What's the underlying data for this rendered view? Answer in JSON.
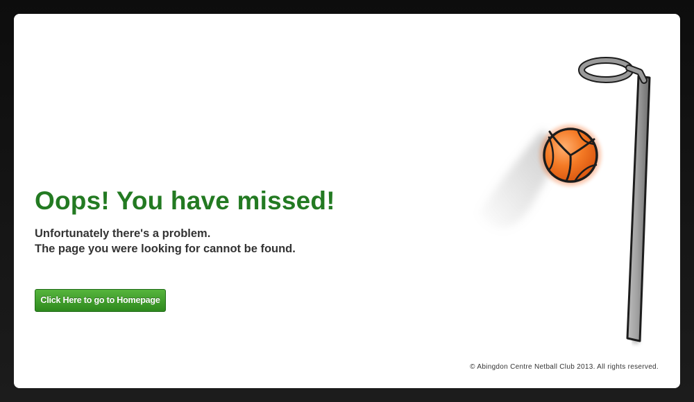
{
  "error": {
    "heading": "Oops! You have missed!",
    "line1": "Unfortunately there's a problem.",
    "line2": "The page you were looking for cannot be found."
  },
  "actions": {
    "home_label": "Click Here to go to Homepage"
  },
  "footer": {
    "copyright": "© Abingdon Centre Netball Club 2013. All rights reserved."
  },
  "illustration": {
    "icons": [
      "netball-hoop-icon",
      "netball-icon"
    ],
    "ball_color": "#f2711f",
    "post_color": "#8a8a8a",
    "accent_color": "#237a22"
  }
}
